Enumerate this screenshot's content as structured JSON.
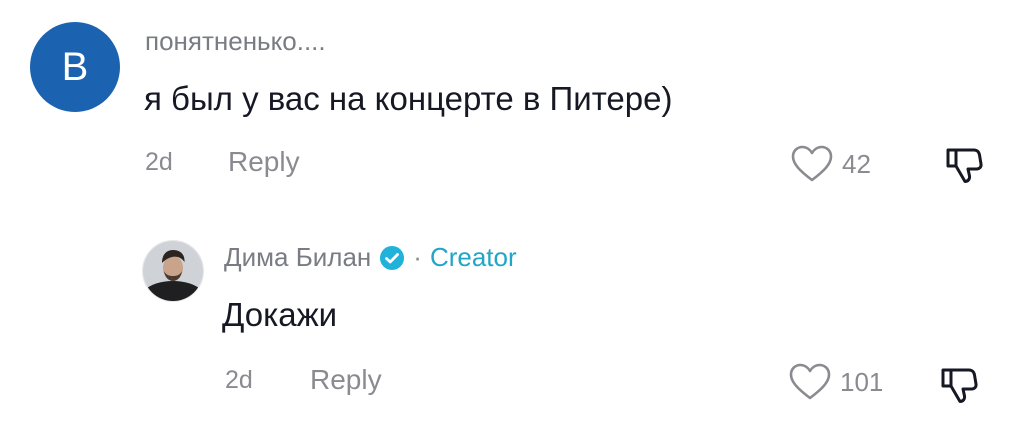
{
  "comments": [
    {
      "avatar_letter": "B",
      "avatar_color": "#1b62b0",
      "author": "понятненько....",
      "text": "я был у вас на концерте в Питере)",
      "time": "2d",
      "reply_label": "Reply",
      "likes": "42",
      "icons": [
        "heart-icon",
        "thumbs-down-icon"
      ]
    }
  ],
  "reply": {
    "author": "Дима Билан",
    "verified_icon": "verified-check-icon",
    "separator": "·",
    "role": "Creator",
    "role_color": "#22a6c8",
    "text": "Докажи",
    "time": "2d",
    "reply_label": "Reply",
    "likes": "101",
    "icons": [
      "heart-icon",
      "thumbs-down-icon"
    ]
  }
}
